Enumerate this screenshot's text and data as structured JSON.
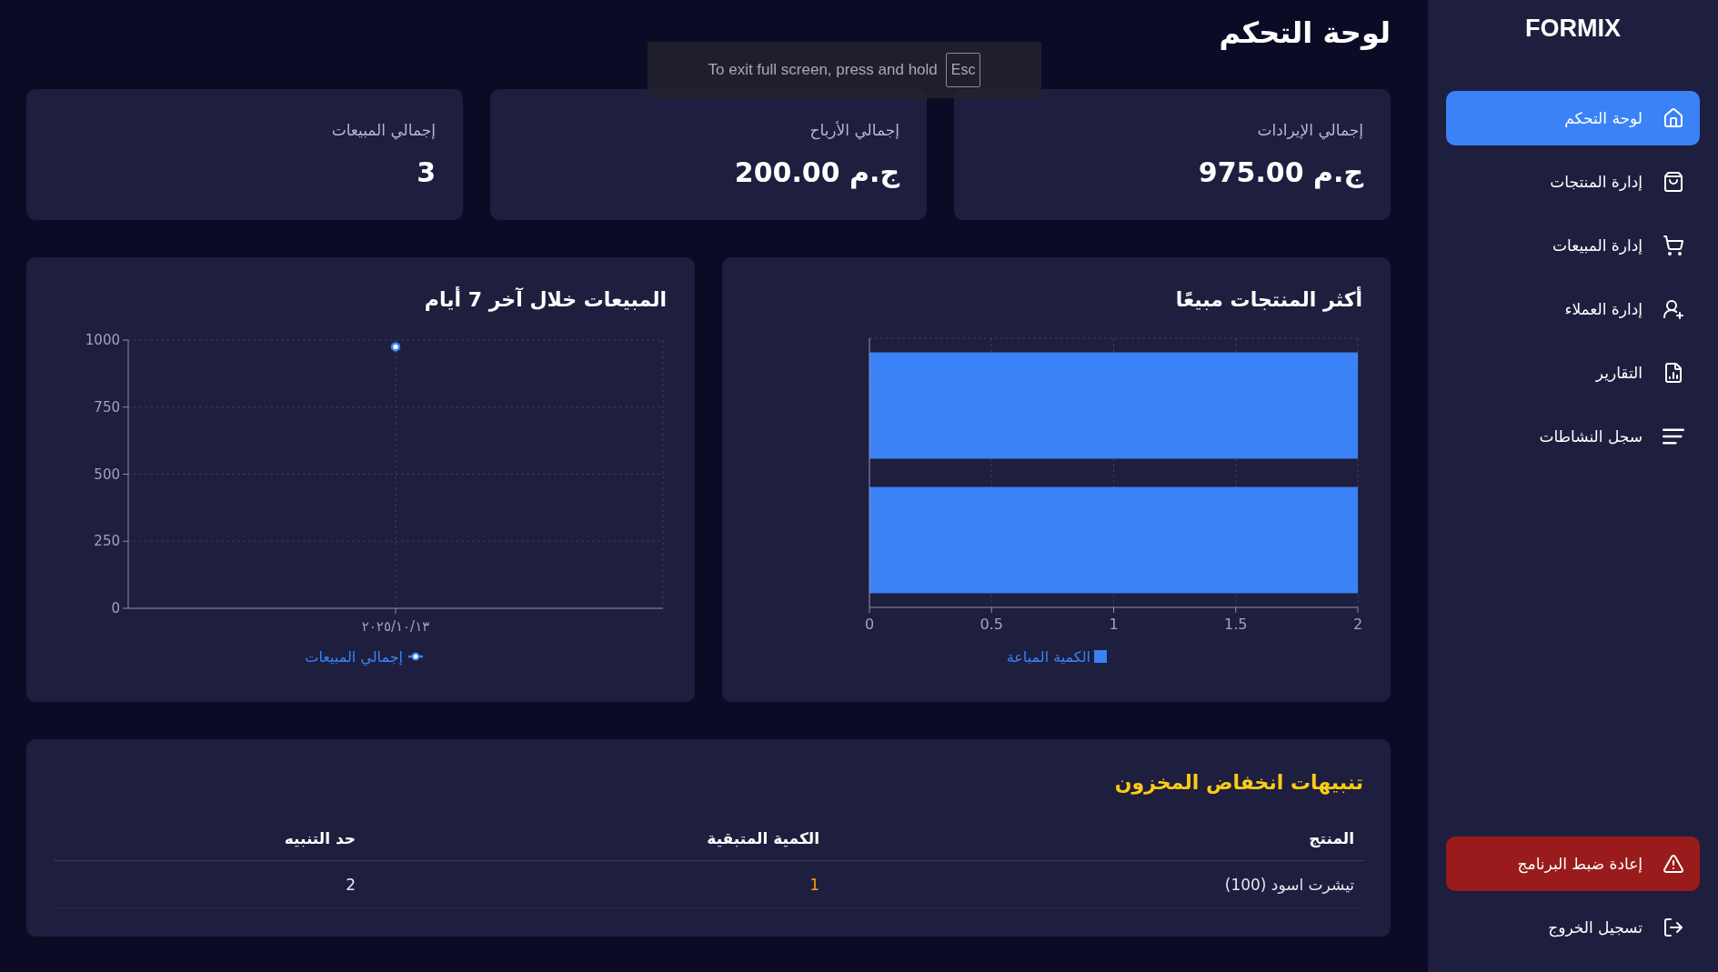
{
  "fullscreen_notice": {
    "text": "To exit full screen, press and hold",
    "key": "Esc"
  },
  "sidebar": {
    "logo": "FORMIX",
    "items": [
      {
        "label": "لوحة التحكم",
        "selected": true
      },
      {
        "label": "إدارة المنتجات",
        "selected": false
      },
      {
        "label": "إدارة المبيعات",
        "selected": false
      },
      {
        "label": "إدارة العملاء",
        "selected": false
      },
      {
        "label": "التقارير",
        "selected": false
      },
      {
        "label": "سجل النشاطات",
        "selected": false
      }
    ],
    "reset_button": "إعادة ضبط البرنامج",
    "logout_button": "تسجيل الخروج"
  },
  "page_title": "لوحة التحكم",
  "stats": [
    {
      "label": "إجمالي الإيرادات",
      "value": "ج.م 975.00"
    },
    {
      "label": "إجمالي الأرباح",
      "value": "ج.م 200.00"
    },
    {
      "label": "إجمالي المبيعات",
      "value": "3"
    }
  ],
  "charts": [
    {
      "chart_data": {
        "type": "bar",
        "orientation": "horizontal",
        "title": "أكثر المنتجات مبيعًا",
        "categories": [
          null,
          null
        ],
        "series": [
          {
            "name": "الكمية المباعة",
            "color": "#3b82f6",
            "values": [
              2,
              2
            ]
          }
        ],
        "xticks": [
          0,
          0.5,
          1,
          1.5,
          2
        ],
        "xlim": [
          0,
          2
        ],
        "tick_labels": "x",
        "grid": true,
        "legend": "bottom"
      }
    },
    {
      "chart_data": {
        "type": "line",
        "title": "المبيعات خلال آخر 7 أيام",
        "categories": [
          "٢٠٢٥/١٠/١٣"
        ],
        "series": [
          {
            "name": "إجمالي المبيعات",
            "color": "#3b82f6",
            "values": [
              975
            ]
          }
        ],
        "yticks": [
          0,
          250,
          500,
          750,
          1000
        ],
        "ylim": [
          0,
          1000
        ],
        "grid": true,
        "marker": "circle",
        "legend": "bottom"
      }
    }
  ],
  "low_stock": {
    "title": "تنبيهات انخفاض المخزون",
    "columns": [
      "المنتج",
      "الكمية المتبقية",
      "حد التنبيه"
    ],
    "rows": [
      [
        "تيشرت اسود (100)",
        "1",
        "2"
      ]
    ]
  }
}
